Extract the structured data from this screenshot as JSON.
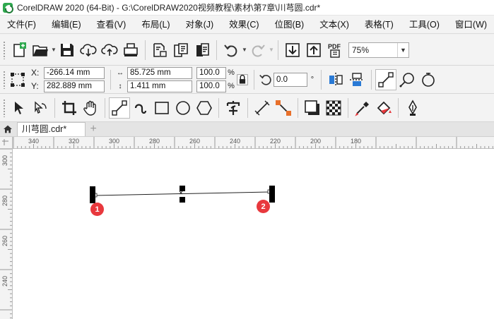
{
  "window": {
    "title": "CorelDRAW 2020 (64-Bit) - G:\\CorelDRAW2020视频教程\\素材\\第7章\\川芎圆.cdr*"
  },
  "menu": [
    {
      "label": "文件(F)"
    },
    {
      "label": "编辑(E)"
    },
    {
      "label": "查看(V)"
    },
    {
      "label": "布局(L)"
    },
    {
      "label": "对象(J)"
    },
    {
      "label": "效果(C)"
    },
    {
      "label": "位图(B)"
    },
    {
      "label": "文本(X)"
    },
    {
      "label": "表格(T)"
    },
    {
      "label": "工具(O)"
    },
    {
      "label": "窗口(W)"
    }
  ],
  "standard_toolbar": {
    "zoom": "75%",
    "pdf_label": "PDF"
  },
  "property_bar": {
    "x_label": "X:",
    "x_value": "-266.14 mm",
    "y_label": "Y:",
    "y_value": "282.889 mm",
    "width_value": "85.725 mm",
    "height_value": "1.411 mm",
    "scale_x": "100.0",
    "scale_y": "100.0",
    "percent": "%",
    "rotation_value": "0.0",
    "degree": "°"
  },
  "document_tab": {
    "label": "川芎圆.cdr*",
    "add": "+"
  },
  "ruler": {
    "h_labels": [
      "340",
      "320",
      "300",
      "280",
      "260",
      "240",
      "220",
      "200",
      "180"
    ],
    "v_labels": [
      "300",
      "280",
      "260",
      "240"
    ]
  },
  "canvas": {
    "badges": [
      {
        "label": "1"
      },
      {
        "label": "2"
      }
    ]
  },
  "colors": {
    "accent": "#2a7ad5",
    "badge": "#e8383d",
    "ruler_bg": "#f3f3f3"
  }
}
